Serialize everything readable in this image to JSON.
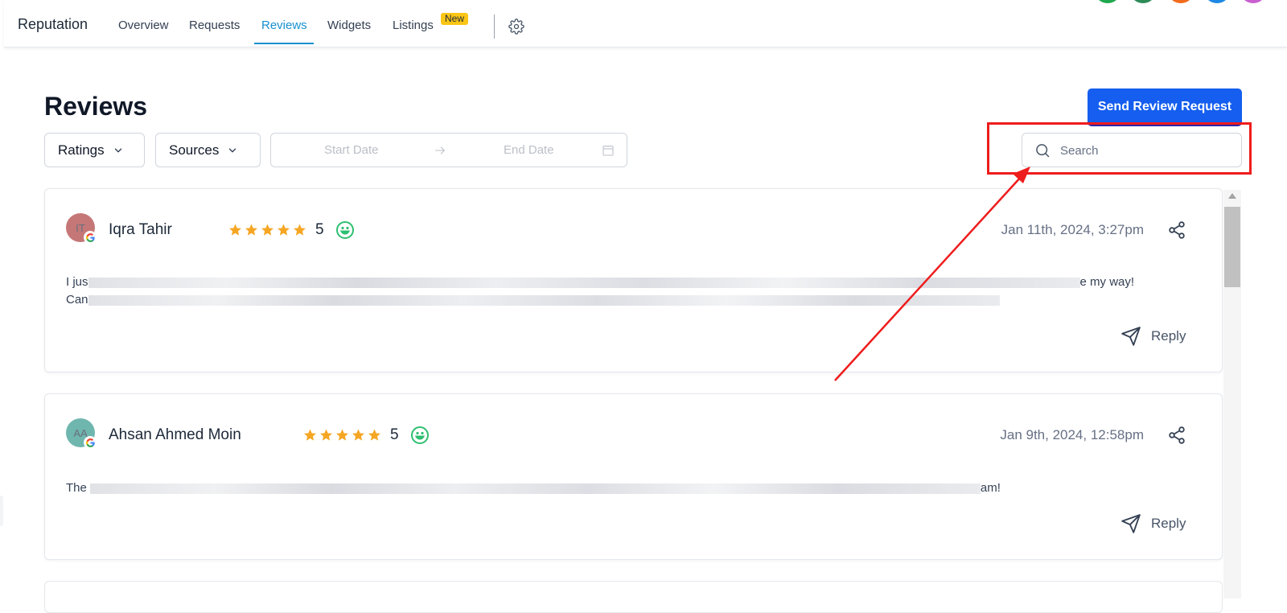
{
  "nav": {
    "brand": "Reputation",
    "tabs": [
      {
        "label": "Overview"
      },
      {
        "label": "Requests"
      },
      {
        "label": "Reviews",
        "active": true
      },
      {
        "label": "Widgets"
      },
      {
        "label": "Listings",
        "badge": "New"
      }
    ],
    "settings_icon": "gear-icon",
    "avatar_colors": [
      "#1fa84f",
      "#2e8b57",
      "#f26b1d",
      "#1e88e5",
      "#c95fd1"
    ]
  },
  "page": {
    "title": "Reviews",
    "send_button": "Send Review Request"
  },
  "filters": {
    "ratings_label": "Ratings",
    "sources_label": "Sources",
    "start_date_placeholder": "Start Date",
    "end_date_placeholder": "End Date",
    "search_placeholder": "Search"
  },
  "annotation": {
    "highlight_color": "#ee1c1c",
    "target": "search-input"
  },
  "reviews": [
    {
      "initials": "IT",
      "avatar_color": "#b24a4a",
      "source_icon": "google-icon",
      "name": "Iqra Tahir",
      "rating": 5,
      "rating_text": "5",
      "sentiment_icon": "smile-icon",
      "date": "Jan 11th, 2024, 3:27pm",
      "text_line1_start": "I jus",
      "text_line1_end": "e my way!",
      "text_line2_start": "Can",
      "reply_label": "Reply"
    },
    {
      "initials": "AA",
      "avatar_color": "#3f9e94",
      "source_icon": "google-icon",
      "name": "Ahsan Ahmed Moin",
      "rating": 5,
      "rating_text": "5",
      "sentiment_icon": "smile-icon",
      "date": "Jan 9th, 2024, 12:58pm",
      "text_line1_start": "The",
      "text_line1_end": "am!",
      "reply_label": "Reply"
    }
  ],
  "colors": {
    "accent": "#1890d0",
    "primary_button": "#155eef",
    "star": "#f5a623",
    "sentiment": "#2fbf71",
    "badge": "#fac515"
  }
}
